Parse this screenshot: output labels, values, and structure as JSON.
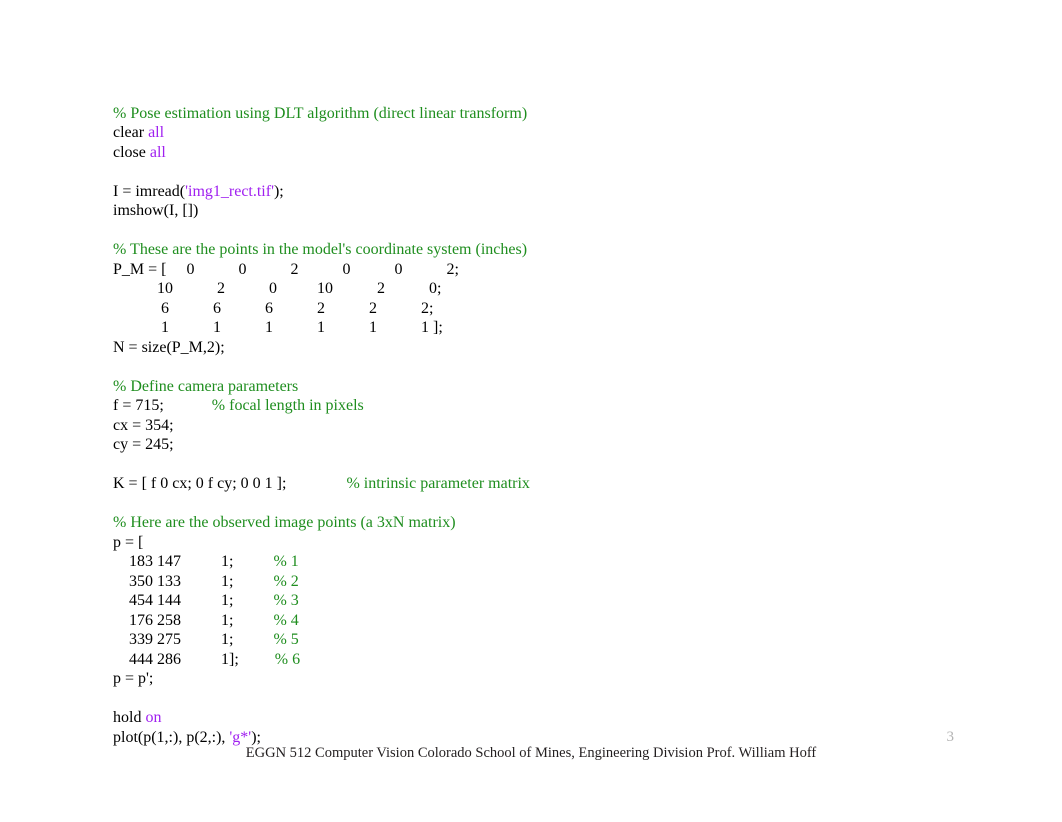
{
  "code": {
    "c1": "% Pose estimation using DLT algorithm (direct linear transform)",
    "l2a": "clear ",
    "l2b": "all",
    "l3a": "close ",
    "l3b": "all",
    "l4a": "I = imread(",
    "l4b": "'img1_rect.tif'",
    "l4c": ");",
    "l5": "imshow(I, [])",
    "c6": "% These are the points in the model's coordinate system (inches)",
    "l7": "P_M = [     0           0           2           0           0           2;",
    "l8": "           10           2           0          10           2           0;",
    "l9": "            6           6           6           2           2           2;",
    "l10": "            1           1           1           1           1           1 ];",
    "l11": "N = size(P_M,2);",
    "c12": "% Define camera parameters",
    "l13a": "f = 715;            ",
    "l13b": "% focal length in pixels",
    "l14": "cx = 354;",
    "l15": "cy = 245;",
    "l16a": "K = [ f 0 cx; 0 f cy; 0 0 1 ];               ",
    "l16b": "% intrinsic parameter matrix",
    "c17": "% Here are the observed image points (a 3xN matrix)",
    "l18": "p = [",
    "l19a": "    183 147          1;          ",
    "l19b": "% 1",
    "l20a": "    350 133          1;          ",
    "l20b": "% 2",
    "l21a": "    454 144          1;          ",
    "l21b": "% 3",
    "l22a": "    176 258          1;          ",
    "l22b": "% 4",
    "l23a": "    339 275          1;          ",
    "l23b": "% 5",
    "l24a": "    444 286          1];         ",
    "l24b": "% 6",
    "l25": "p = p';",
    "l26a": "hold ",
    "l26b": "on",
    "l27a": "plot(p(1,:), p(2,:), ",
    "l27b": "'g*'",
    "l27c": ");"
  },
  "footer": "EGGN 512  Computer Vision  Colorado School of Mines, Engineering Division   Prof. William Hoff",
  "page_num": "3"
}
